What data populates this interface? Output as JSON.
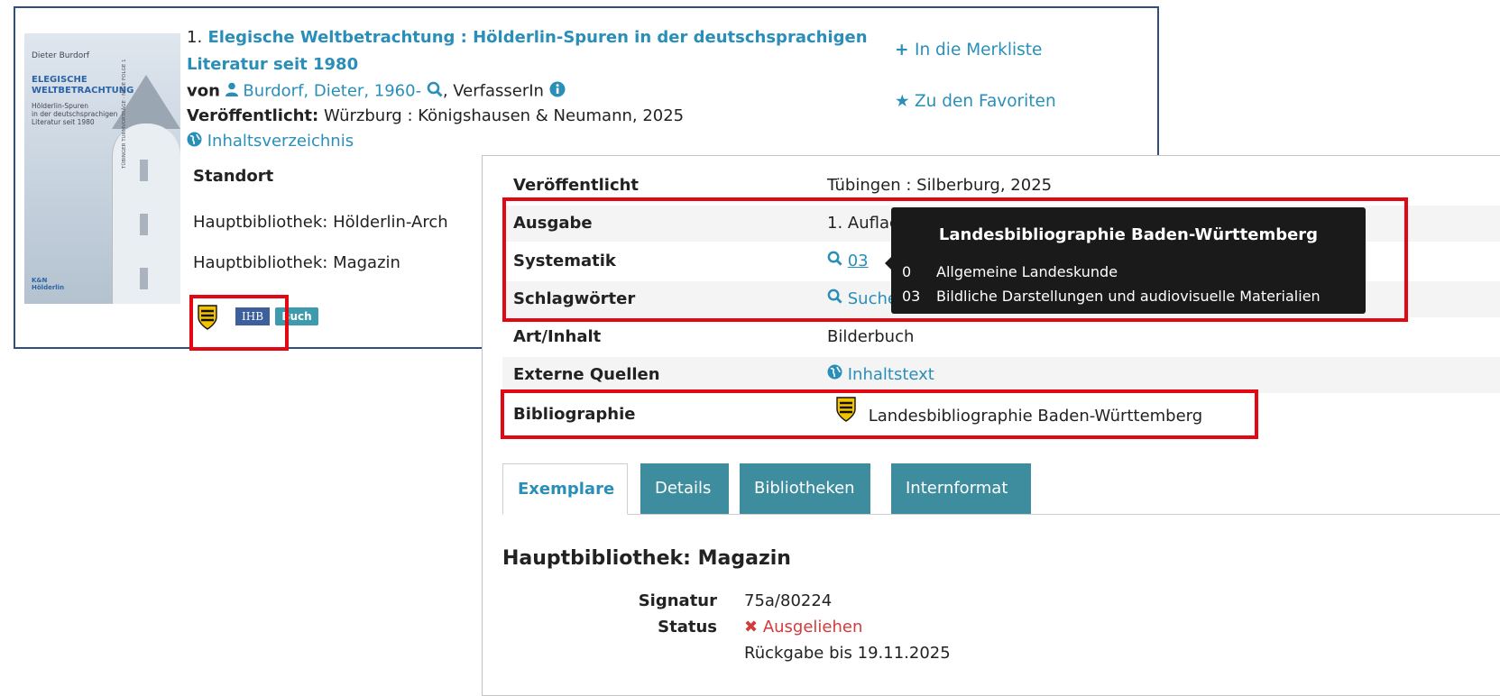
{
  "result": {
    "number": "1.",
    "title": "Elegische Weltbetrachtung : Hölderlin-Spuren in der deutschsprachigen Literatur seit 1980",
    "von_label": "von",
    "author": "Burdorf, Dieter, 1960-",
    "role": ", VerfasserIn",
    "published_label": "Veröffentlicht:",
    "published": "Würzburg : Königshausen & Neumann, 2025",
    "toc_link": "Inhaltsverzeichnis",
    "standort_label": "Standort",
    "locations": [
      "Hauptbibliothek: Hölderlin-Arch",
      "Hauptbibliothek: Magazin"
    ],
    "actions": {
      "merkliste": "In die Merkliste",
      "favoriten": "Zu den Favoriten"
    },
    "badges": {
      "ihb": "IHB",
      "buch": "Buch"
    },
    "cover": {
      "author": "Dieter Burdorf",
      "title_lines": [
        "ELEGISCHE",
        "WELTBETRACHTUNG"
      ],
      "subtitle_lines": [
        "Hölderlin-Spuren",
        "in der deutschsprachigen",
        "Literatur seit 1980"
      ],
      "publisher_lines": [
        "K&N",
        "Hölderlin"
      ],
      "spine": "TÜBINGER TURMVORTRÄGE · NEUE FOLGE 1"
    }
  },
  "detail": {
    "rows": [
      {
        "key": "Veröffentlicht",
        "value": "Tübingen : Silberburg, 2025"
      },
      {
        "key": "Ausgabe",
        "value": "1. Auflage"
      },
      {
        "key": "Systematik",
        "value": "03"
      },
      {
        "key": "Schlagwörter",
        "value": "Suche"
      },
      {
        "key": "Art/Inhalt",
        "value": "Bilderbuch"
      },
      {
        "key": "Externe Quellen",
        "value": "Inhaltstext"
      },
      {
        "key": "Bibliographie",
        "value": "Landesbibliographie Baden-Württemberg"
      }
    ],
    "tabs": [
      "Exemplare",
      "Details",
      "Bibliotheken",
      "Internformat"
    ],
    "holding": {
      "heading": "Hauptbibliothek: Magazin",
      "signatur_label": "Signatur",
      "signatur": "75a/80224",
      "status_label": "Status",
      "status": "Ausgeliehen",
      "return": "Rückgabe bis 19.11.2025"
    }
  },
  "tooltip": {
    "title": "Landesbibliographie Baden-Württemberg",
    "items": [
      {
        "code": "0",
        "label": "Allgemeine Landeskunde"
      },
      {
        "code": "03",
        "label": "Bildliche Darstellungen und audiovisuelle Materialien"
      }
    ]
  },
  "colors": {
    "link": "#2a8fb8",
    "highlight": "#e30613",
    "tab": "#3e8d9e",
    "card_border": "#2f4f7f"
  },
  "icons": [
    "user-icon",
    "search-icon",
    "info-icon",
    "globe-icon",
    "plus-icon",
    "star-icon",
    "shield-icon",
    "times-icon"
  ]
}
